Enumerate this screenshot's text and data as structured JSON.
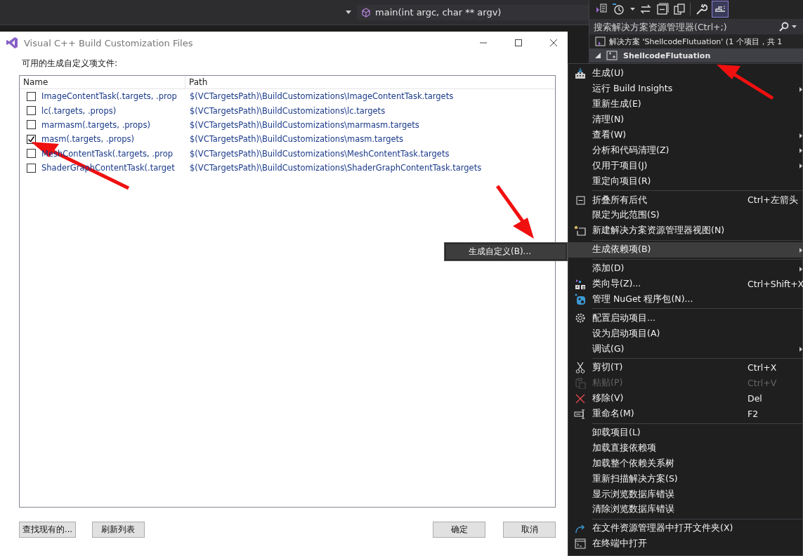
{
  "editor_bar": {
    "function": "main(int argc, char ** argv)"
  },
  "solution_explorer": {
    "search": {
      "placeholder": "搜索解决方案资源管理器(Ctrl+;)"
    },
    "tree": [
      {
        "label": "解决方案 'ShellcodeFlutuation' (1 个项目，共 1",
        "children": [
          {
            "label": "ShellcodeFlutuation",
            "expanded": true
          }
        ]
      }
    ]
  },
  "dialog": {
    "title": "Visual C++ Build Customization Files",
    "label": "可用的生成自定义项文件:",
    "columns": [
      "Name",
      "Path"
    ],
    "rows": [
      {
        "name": "ImageContentTask(.targets, .prop",
        "path": "$(VCTargetsPath)\\BuildCustomizations\\ImageContentTask.targets",
        "checked": false
      },
      {
        "name": "lc(.targets, .props)",
        "path": "$(VCTargetsPath)\\BuildCustomizations\\lc.targets",
        "checked": false
      },
      {
        "name": "marmasm(.targets, .props)",
        "path": "$(VCTargetsPath)\\BuildCustomizations\\marmasm.targets",
        "checked": false
      },
      {
        "name": "masm(.targets, .props)",
        "path": "$(VCTargetsPath)\\BuildCustomizations\\masm.targets",
        "checked": true
      },
      {
        "name": "MeshContentTask(.targets, .prop",
        "path": "$(VCTargetsPath)\\BuildCustomizations\\MeshContentTask.targets",
        "checked": false
      },
      {
        "name": "ShaderGraphContentTask(.target",
        "path": "$(VCTargetsPath)\\BuildCustomizations\\ShaderGraphContentTask.targets",
        "checked": false
      }
    ],
    "left_buttons": [
      "查找现有的...",
      "刷新列表"
    ],
    "right_buttons": [
      "确定",
      "取消"
    ]
  },
  "submenu": {
    "items": [
      "生成自定义(B)..."
    ]
  },
  "context_menu": {
    "items": [
      {
        "kind": "build",
        "label": "生成(U)",
        "submenu": false,
        "selected": false,
        "disabled": false
      },
      {
        "kind": "item",
        "label": "运行 Build Insights",
        "submenu": true,
        "selected": false,
        "disabled": false
      },
      {
        "kind": "item",
        "label": "重新生成(E)",
        "submenu": false,
        "selected": false,
        "disabled": false
      },
      {
        "kind": "item",
        "label": "清理(N)",
        "submenu": false,
        "selected": false,
        "disabled": false
      },
      {
        "kind": "item",
        "label": "查看(W)",
        "submenu": true,
        "selected": false,
        "disabled": false
      },
      {
        "kind": "item",
        "label": "分析和代码清理(Z)",
        "submenu": true,
        "selected": false,
        "disabled": false
      },
      {
        "kind": "item",
        "label": "仅用于项目(J)",
        "submenu": true,
        "selected": false,
        "disabled": false
      },
      {
        "kind": "item",
        "label": "重定向项目(R)",
        "submenu": false,
        "selected": false,
        "disabled": false
      },
      {
        "kind": "separator"
      },
      {
        "kind": "collapse",
        "label": "折叠所有后代",
        "shortcut": "Ctrl+左箭头",
        "submenu": false,
        "selected": false,
        "disabled": false
      },
      {
        "kind": "item",
        "label": "限定为此范围(S)",
        "submenu": false,
        "selected": false,
        "disabled": false
      },
      {
        "kind": "newview",
        "label": "新建解决方案资源管理器视图(N)",
        "submenu": false,
        "selected": false,
        "disabled": false
      },
      {
        "kind": "separator"
      },
      {
        "kind": "item",
        "label": "生成依赖项(B)",
        "submenu": true,
        "selected": true,
        "disabled": false
      },
      {
        "kind": "separator"
      },
      {
        "kind": "item",
        "label": "添加(D)",
        "submenu": true,
        "selected": false,
        "disabled": false
      },
      {
        "kind": "classwizard",
        "label": "类向导(Z)...",
        "shortcut": "Ctrl+Shift+X",
        "submenu": false,
        "selected": false,
        "disabled": false
      },
      {
        "kind": "nuget",
        "label": "管理 NuGet 程序包(N)...",
        "submenu": false,
        "selected": false,
        "disabled": false
      },
      {
        "kind": "separator"
      },
      {
        "kind": "gear",
        "label": "配置启动项目...",
        "submenu": false,
        "selected": false,
        "disabled": false
      },
      {
        "kind": "item",
        "label": "设为启动项目(A)",
        "submenu": false,
        "selected": false,
        "disabled": false
      },
      {
        "kind": "item",
        "label": "调试(G)",
        "submenu": true,
        "selected": false,
        "disabled": false
      },
      {
        "kind": "separator"
      },
      {
        "kind": "cut",
        "label": "剪切(T)",
        "shortcut": "Ctrl+X",
        "submenu": false,
        "selected": false,
        "disabled": false
      },
      {
        "kind": "paste",
        "label": "粘贴(P)",
        "shortcut": "Ctrl+V",
        "submenu": false,
        "selected": false,
        "disabled": true
      },
      {
        "kind": "remove",
        "label": "移除(V)",
        "shortcut": "Del",
        "submenu": false,
        "selected": false,
        "disabled": false
      },
      {
        "kind": "rename",
        "label": "重命名(M)",
        "shortcut": "F2",
        "submenu": false,
        "selected": false,
        "disabled": false
      },
      {
        "kind": "separator"
      },
      {
        "kind": "item",
        "label": "卸载项目(L)",
        "submenu": false,
        "selected": false,
        "disabled": false
      },
      {
        "kind": "item",
        "label": "加载直接依赖项",
        "submenu": false,
        "selected": false,
        "disabled": false
      },
      {
        "kind": "item",
        "label": "加载整个依赖关系树",
        "submenu": false,
        "selected": false,
        "disabled": false
      },
      {
        "kind": "item",
        "label": "重新扫描解决方案(S)",
        "submenu": false,
        "selected": false,
        "disabled": false
      },
      {
        "kind": "item",
        "label": "显示浏览数据库错误",
        "submenu": false,
        "selected": false,
        "disabled": false
      },
      {
        "kind": "item",
        "label": "清除浏览数据库错误",
        "submenu": false,
        "selected": false,
        "disabled": false
      },
      {
        "kind": "separator"
      },
      {
        "kind": "open",
        "label": "在文件资源管理器中打开文件夹(X)",
        "submenu": false,
        "selected": false,
        "disabled": false
      },
      {
        "kind": "terminal",
        "label": "在终端中打开",
        "submenu": false,
        "selected": false,
        "disabled": false
      }
    ]
  }
}
